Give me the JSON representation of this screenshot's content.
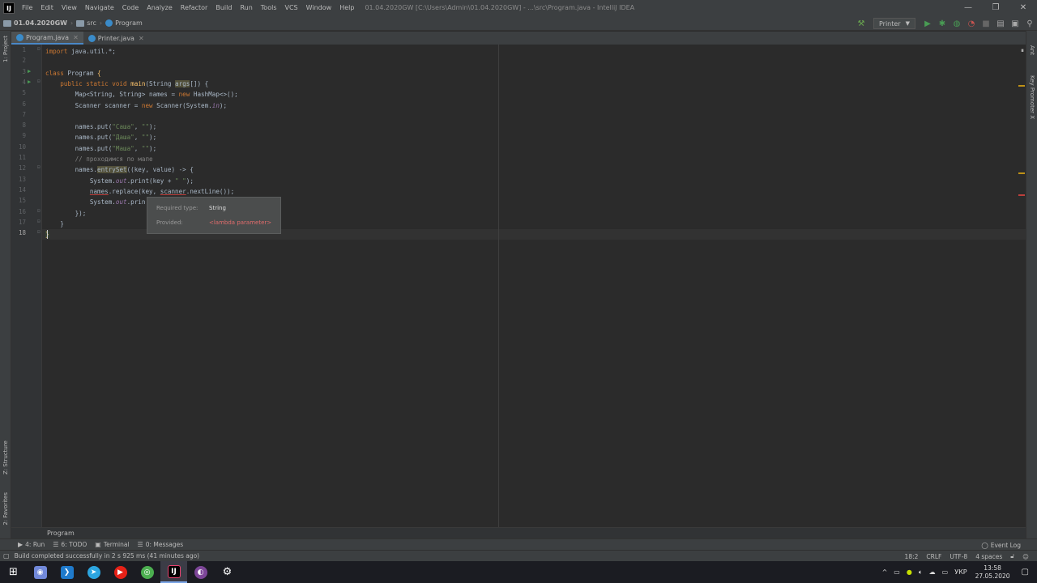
{
  "titlebar": {
    "app_icon": "IJ",
    "menu": [
      "File",
      "Edit",
      "View",
      "Navigate",
      "Code",
      "Analyze",
      "Refactor",
      "Build",
      "Run",
      "Tools",
      "VCS",
      "Window",
      "Help"
    ],
    "window_title": "01.04.2020GW [C:\\Users\\Admin\\01.04.2020GW] - ...\\src\\Program.java - IntelliJ IDEA",
    "minimize": "—",
    "restore": "❐",
    "close": "✕"
  },
  "navbar": {
    "project": "01.04.2020GW",
    "folder": "src",
    "file": "Program",
    "run_config": "Printer"
  },
  "tabs": [
    {
      "label": "Program.java",
      "active": true
    },
    {
      "label": "Printer.java",
      "active": false
    }
  ],
  "left_strip": {
    "project": "1: Project",
    "structure": "Z: Structure",
    "favorites": "2: Favorites"
  },
  "right_strip": {
    "ant": "Ant",
    "key_promoter": "Key Promoter X"
  },
  "gutter": {
    "lines": [
      "1",
      "2",
      "3",
      "4",
      "5",
      "6",
      "7",
      "8",
      "9",
      "10",
      "11",
      "12",
      "13",
      "14",
      "15",
      "16",
      "17",
      "18"
    ]
  },
  "code": {
    "l1_kw": "import",
    "l1_rest": " java.util.*;",
    "l3_kw": "class",
    "l3_name": " Program ",
    "l3_brace": "{",
    "l4_kw": "    public static void",
    "l4_sp": " ",
    "l4_fn": "main",
    "l4_p1": "(String ",
    "l4_args": "args",
    "l4_p2": "[]) {",
    "l5_a": "        Map<String, String> names = ",
    "l5_kw": "new",
    "l5_b": " HashMap<>();",
    "l6_a": "        Scanner scanner = ",
    "l6_kw": "new",
    "l6_b": " Scanner(System.",
    "l6_in": "in",
    "l6_c": ");",
    "l8_a": "        names.put(",
    "l8_s1": "\"Саша\"",
    "l8_b": ", ",
    "l8_s2": "\"\"",
    "l8_c": ");",
    "l9_a": "        names.put(",
    "l9_s1": "\"Даша\"",
    "l9_b": ", ",
    "l9_s2": "\"\"",
    "l9_c": ");",
    "l10_a": "        names.put(",
    "l10_s1": "\"Маша\"",
    "l10_b": ", ",
    "l10_s2": "\"\"",
    "l10_c": ");",
    "l11_cm": "        // проходимся по мапе",
    "l12_a": "        names.",
    "l12_fn": "entrySet",
    "l12_b": "((key, value) -> {",
    "l13_a": "            System.",
    "l13_out": "out",
    "l13_b": ".print(key + ",
    "l13_s": "\" \"",
    "l13_c": ");",
    "l14_a": "            ",
    "l14_names": "names",
    "l14_b": ".replace(key, ",
    "l14_scanner": "scanner",
    "l14_c": ".nextLine());",
    "l15_a": "            System.",
    "l15_out": "out",
    "l15_b": ".prin",
    "l16": "        });",
    "l17": "    }",
    "l18": "}"
  },
  "tooltip": {
    "required_label": "Required type:",
    "required_value": "String",
    "provided_label": "Provided:",
    "provided_value": "<lambda parameter>"
  },
  "breadcrumb_bottom": "Program",
  "toolwindows": {
    "run": "4: Run",
    "todo": "6: TODO",
    "terminal": "Terminal",
    "messages": "0: Messages",
    "event_log": "Event Log"
  },
  "status": {
    "message": "Build completed successfully in 2 s 925 ms (41 minutes ago)",
    "position": "18:2",
    "line_sep": "CRLF",
    "encoding": "UTF-8",
    "indent": "4 spaces"
  },
  "taskbar": {
    "lang": "УКР",
    "time": "13:58",
    "date": "27.05.2020"
  }
}
